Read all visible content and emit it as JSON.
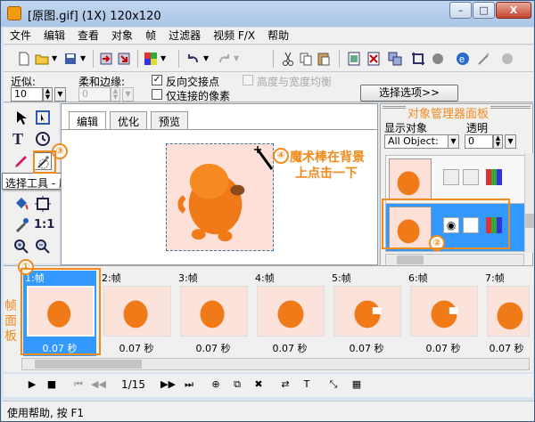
{
  "window": {
    "title": "[原图.gif] (1X) 120x120",
    "min_label": "–",
    "max_label": "□",
    "close_label": "X"
  },
  "menu": [
    "文件",
    "编辑",
    "查看",
    "对象",
    "帧",
    "过滤器",
    "视频 F/X",
    "帮助"
  ],
  "options": {
    "proximity_label": "近似:",
    "proximity_value": "10",
    "feather_label": "柔和边缘:",
    "feather_value": "0",
    "invert_label": "反向交接点",
    "invert_checked": true,
    "keep_ratio_label": "高度与宽度均衡",
    "connected_label": "仅连接的像素",
    "select_options_label": "选择选项>>"
  },
  "tooltip": "选择工具 - 魔术棒",
  "tabs": [
    "编辑",
    "优化",
    "预览"
  ],
  "object_manager": {
    "title": "对象管理器面板",
    "display_label": "显示对象",
    "display_value": "All Object:",
    "alpha_label": "透明",
    "alpha_value": "0"
  },
  "annotations": {
    "a1": "①",
    "a2": "②",
    "a3": "③",
    "a4_num": "④",
    "a4_line1": "魔术棒在背景",
    "a4_line2": "上点击一下",
    "frame_panel": "帧面板"
  },
  "frames": [
    {
      "label": "1:帧",
      "time": "0.07 秒",
      "selected": true
    },
    {
      "label": "2:帧",
      "time": "0.07 秒",
      "selected": false
    },
    {
      "label": "3:帧",
      "time": "0.07 秒",
      "selected": false
    },
    {
      "label": "4:帧",
      "time": "0.07 秒",
      "selected": false
    },
    {
      "label": "5:帧",
      "time": "0.07 秒",
      "selected": false
    },
    {
      "label": "6:帧",
      "time": "0.07 秒",
      "selected": false
    },
    {
      "label": "7:帧",
      "time": "0.07 秒",
      "selected": false
    }
  ],
  "frame_counter": "1/15",
  "status": "使用帮助, 按 F1",
  "icons": [
    "new-icon",
    "open-icon",
    "save-icon",
    "import-icon",
    "export-icon",
    "color-icon",
    "undo-icon",
    "redo-icon",
    "cut-icon",
    "copy-icon",
    "paste-icon",
    "frame-add-icon",
    "frame-remove-icon",
    "crop-icon",
    "effect-icon",
    "browser-icon",
    "magic-wand-icon"
  ],
  "colors": {
    "accent": "#f28a1c",
    "selection": "#3399ff",
    "canvas_bg": "#fde0d8"
  }
}
